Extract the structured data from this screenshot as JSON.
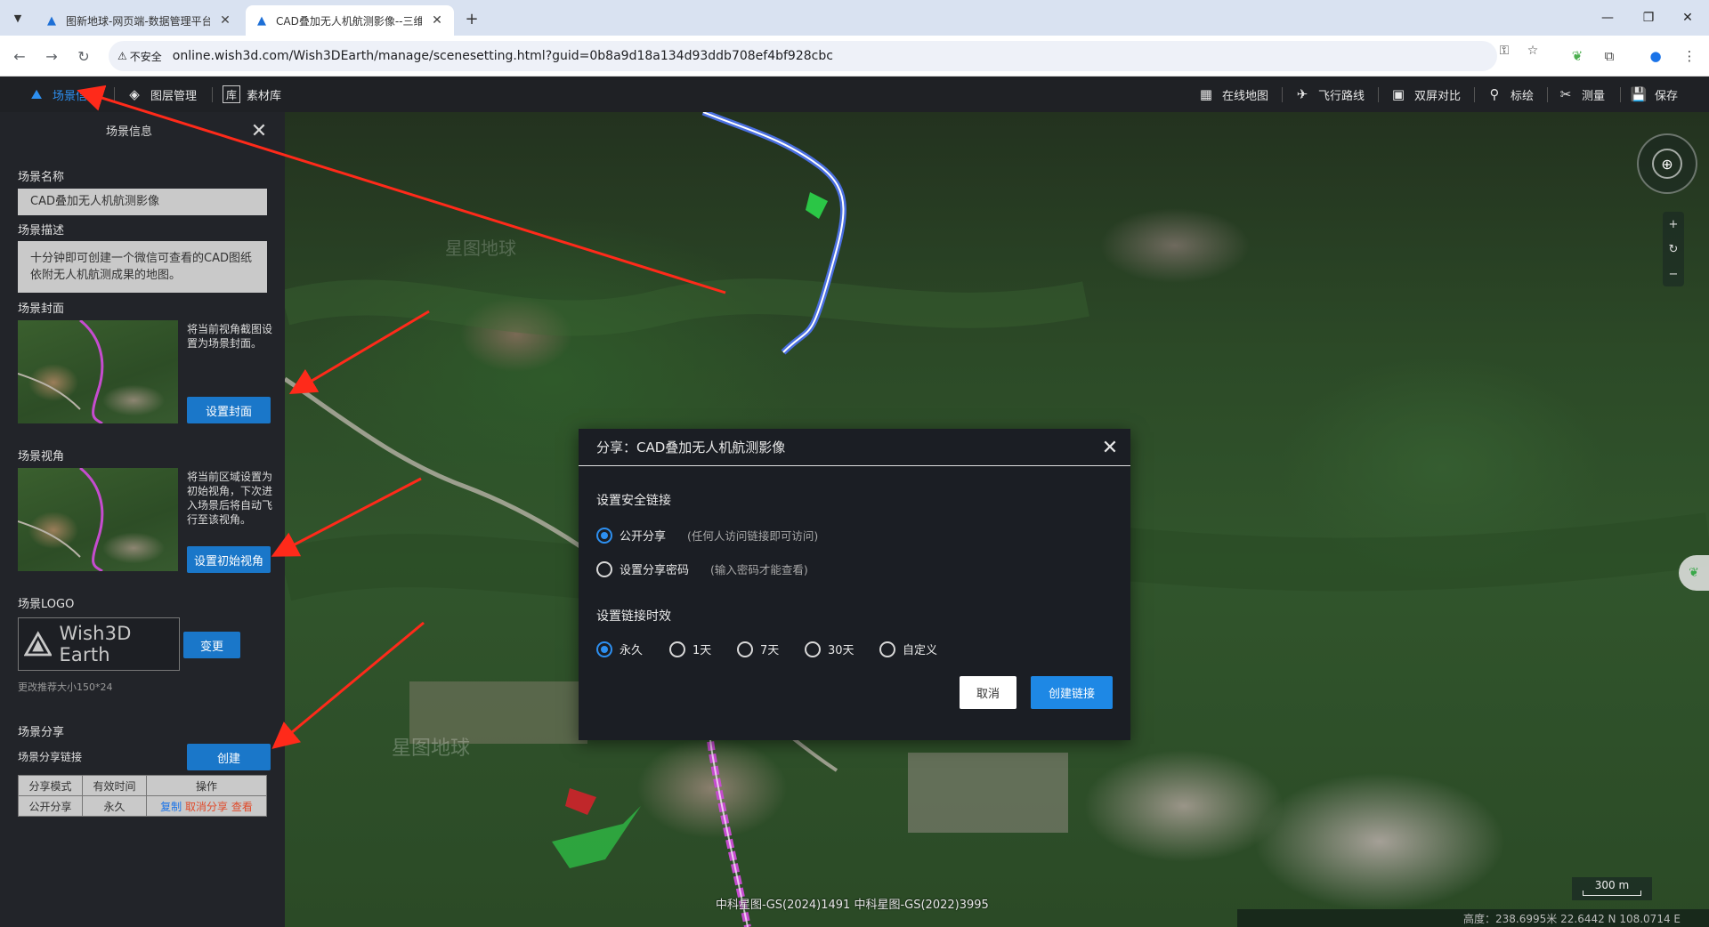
{
  "browser": {
    "tabs": [
      {
        "title": "图新地球-网页端-数据管理平台",
        "active": false
      },
      {
        "title": "CAD叠加无人机航测影像--三维",
        "active": true
      }
    ],
    "security_label": "不安全",
    "url": "online.wish3d.com/Wish3DEarth/manage/scenesetting.html?guid=0b8a9d18a134d93ddb708ef4bf928cbc"
  },
  "app_menu": {
    "left": [
      {
        "label": "场景信息",
        "icon": "scene-info-icon",
        "active": true
      },
      {
        "label": "图层管理",
        "icon": "layers-icon",
        "active": false
      },
      {
        "label": "素材库",
        "icon": "library-icon",
        "active": false
      }
    ],
    "right": [
      {
        "label": "在线地图",
        "icon": "online-map-icon"
      },
      {
        "label": "飞行路线",
        "icon": "flight-route-icon"
      },
      {
        "label": "双屏对比",
        "icon": "dual-screen-icon"
      },
      {
        "label": "标绘",
        "icon": "pin-icon"
      },
      {
        "label": "测量",
        "icon": "measure-icon"
      },
      {
        "label": "保存",
        "icon": "save-icon"
      }
    ]
  },
  "panel": {
    "title": "场景信息",
    "name_label": "场景名称",
    "name_value": "CAD叠加无人机航测影像",
    "desc_label": "场景描述",
    "desc_value": "十分钟即可创建一个微信可查看的CAD图纸依附无人机航测成果的地图。",
    "cover_label": "场景封面",
    "cover_desc": "将当前视角截图设置为场景封面。",
    "cover_button": "设置封面",
    "view_label": "场景视角",
    "view_desc": "将当前区域设置为初始视角，下次进入场景后将自动飞行至该视角。",
    "view_button": "设置初始视角",
    "logo_label": "场景LOGO",
    "logo_text": "Wish3D Earth",
    "logo_button": "变更",
    "logo_hint": "更改推荐大小150*24",
    "share_label": "场景分享",
    "share_link_label": "场景分享链接",
    "share_create_button": "创建",
    "share_table": {
      "headers": [
        "分享模式",
        "有效时间",
        "操作"
      ],
      "rows": [
        {
          "mode": "公开分享",
          "time": "永久",
          "actions": [
            "复制",
            "取消分享",
            "查看"
          ]
        }
      ]
    }
  },
  "modal": {
    "title": "分享：CAD叠加无人机航测影像",
    "security_section": "设置安全链接",
    "security_options": [
      {
        "label": "公开分享",
        "hint": "(任何人访问链接即可访问)",
        "checked": true
      },
      {
        "label": "设置分享密码",
        "hint": "(输入密码才能查看)",
        "checked": false
      }
    ],
    "duration_section": "设置链接时效",
    "duration_options": [
      {
        "label": "永久",
        "checked": true
      },
      {
        "label": "1天",
        "checked": false
      },
      {
        "label": "7天",
        "checked": false
      },
      {
        "label": "30天",
        "checked": false
      },
      {
        "label": "自定义",
        "checked": false
      }
    ],
    "cancel_button": "取消",
    "create_button": "创建链接"
  },
  "map": {
    "copyright": "中科星图-GS(2024)1491 中科星图-GS(2022)3995",
    "scale": "300 m",
    "status": "高度：238.6995米 22.6442 N 108.0714 E"
  },
  "colors": {
    "accent": "#1e88e5",
    "annotation": "#ff2a1a"
  }
}
